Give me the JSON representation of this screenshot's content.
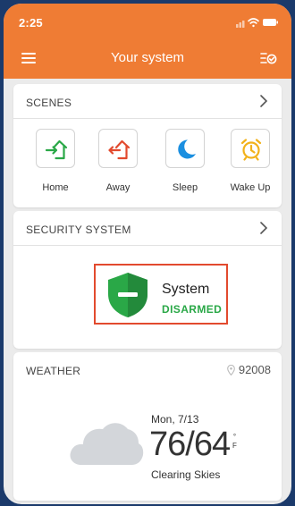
{
  "status_bar": {
    "time": "2:25"
  },
  "header": {
    "title": "Your system"
  },
  "scenes": {
    "title": "SCENES",
    "items": [
      {
        "label": "Home",
        "icon": "home-arrow-in-icon",
        "color": "#2aa847"
      },
      {
        "label": "Away",
        "icon": "home-arrow-out-icon",
        "color": "#e24a2e"
      },
      {
        "label": "Sleep",
        "icon": "moon-icon",
        "color": "#1b8fe0"
      },
      {
        "label": "Wake Up",
        "icon": "alarm-clock-icon",
        "color": "#f2b21b"
      }
    ]
  },
  "security": {
    "title": "SECURITY SYSTEM",
    "system_label": "System",
    "status": "DISARMED",
    "status_color": "#2aa847",
    "shield_icon": "shield-minus-icon"
  },
  "weather": {
    "title": "WEATHER",
    "zip": "92008",
    "date": "Mon, 7/13",
    "temps": "76/64",
    "unit_degree": "°",
    "unit_letter": "F",
    "condition": "Clearing Skies",
    "pages": 2,
    "active_page": 0
  },
  "colors": {
    "brand": "#ef7c34",
    "highlight": "#e24a2e"
  }
}
